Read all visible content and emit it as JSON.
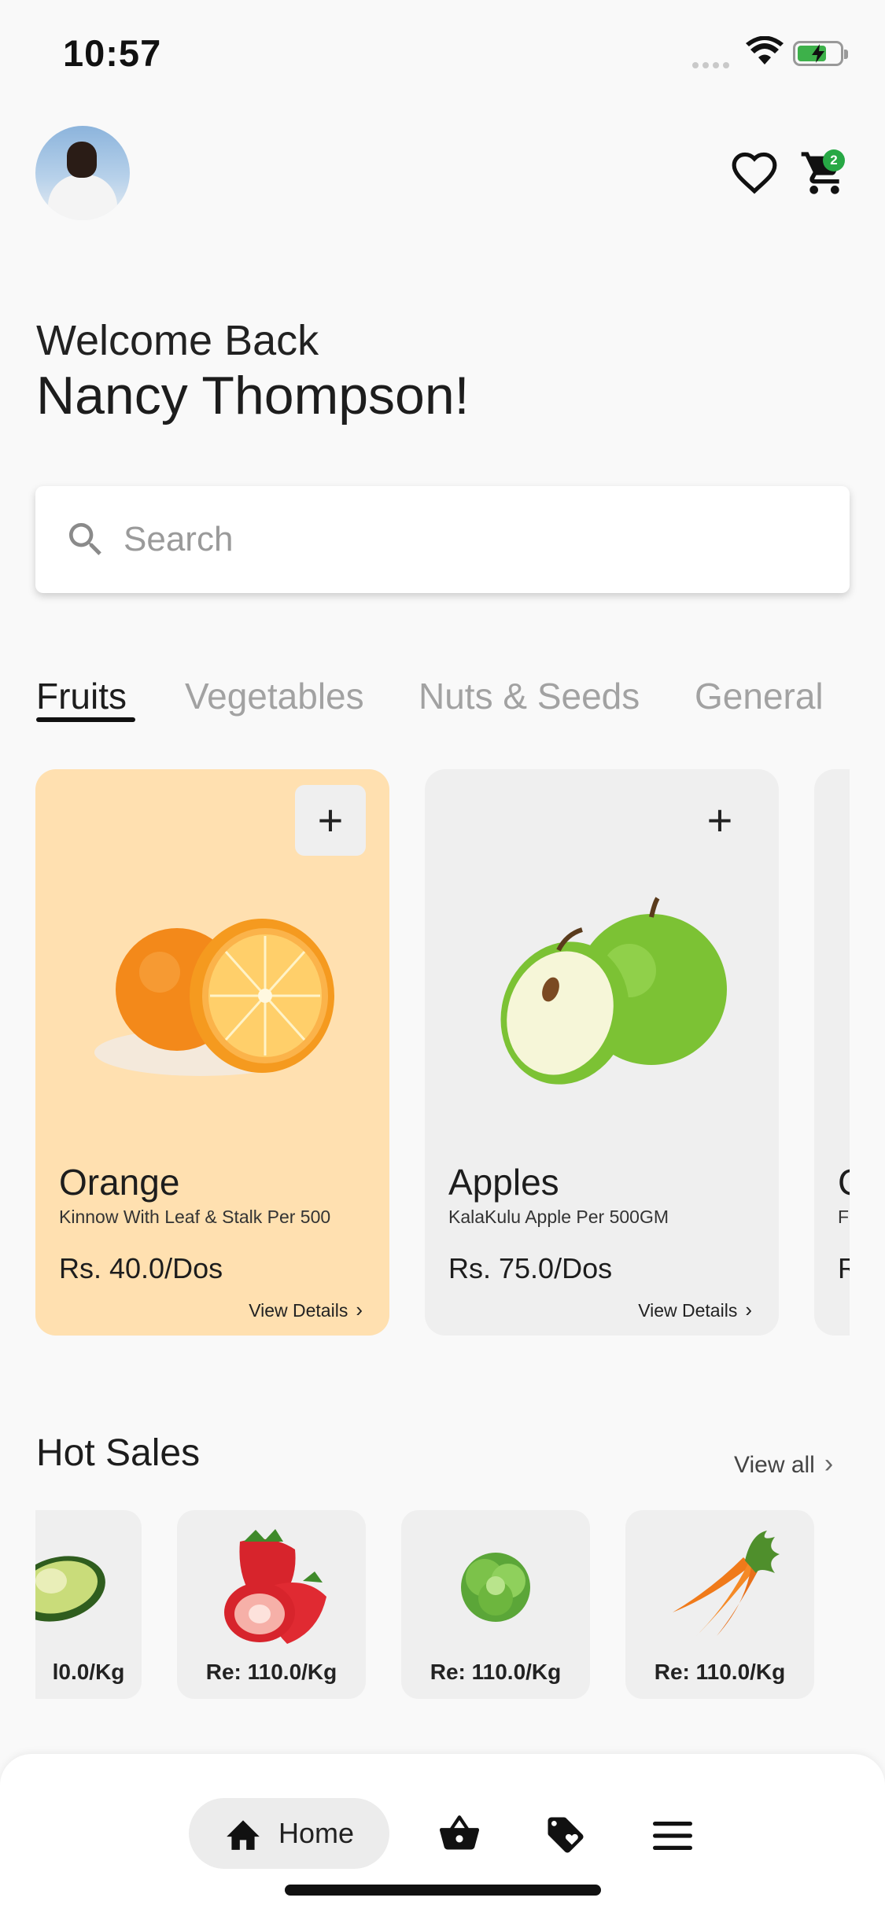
{
  "status_bar": {
    "time": "10:57",
    "battery_color": "#3db14a",
    "icons": [
      "signal-icon",
      "wifi-icon",
      "battery-icon"
    ]
  },
  "header": {
    "avatar": "user-avatar",
    "favorites_icon": "heart-icon",
    "cart_icon": "cart-icon",
    "cart_count": "2"
  },
  "greeting": {
    "line1": "Welcome Back",
    "name": "Nancy Thompson!"
  },
  "search": {
    "placeholder": "Search",
    "value": ""
  },
  "categories": {
    "tabs": [
      "Fruits",
      "Vegetables",
      "Nuts & Seeds",
      "General"
    ],
    "active": "Fruits"
  },
  "products": [
    {
      "name": "Orange",
      "description": "Kinnow With Leaf & Stalk Per 500",
      "price": "Rs. 40.0/Dos",
      "details_label": "View Details",
      "add_label": "+",
      "bg": "#ffe0b0"
    },
    {
      "name": "Apples",
      "description": "KalaKulu Apple Per 500GM",
      "price": "Rs. 75.0/Dos",
      "details_label": "View Details",
      "add_label": "+",
      "bg": "#efefef"
    },
    {
      "name": "C",
      "description": "F",
      "price": "R"
    }
  ],
  "hot_sales": {
    "title": "Hot Sales",
    "view_all": "View all",
    "items": [
      {
        "image": "avocado",
        "price": "l0.0/Kg"
      },
      {
        "image": "strawberries",
        "price": "Re: 110.0/Kg"
      },
      {
        "image": "lettuce",
        "price": "Re: 110.0/Kg"
      },
      {
        "image": "carrots",
        "price": "Re: 110.0/Kg"
      }
    ]
  },
  "bottom_nav": {
    "items": [
      {
        "label": "Home",
        "icon": "home-icon",
        "active": true
      },
      {
        "label": "",
        "icon": "basket-icon"
      },
      {
        "label": "",
        "icon": "tag-heart-icon"
      },
      {
        "label": "",
        "icon": "menu-icon"
      }
    ]
  }
}
